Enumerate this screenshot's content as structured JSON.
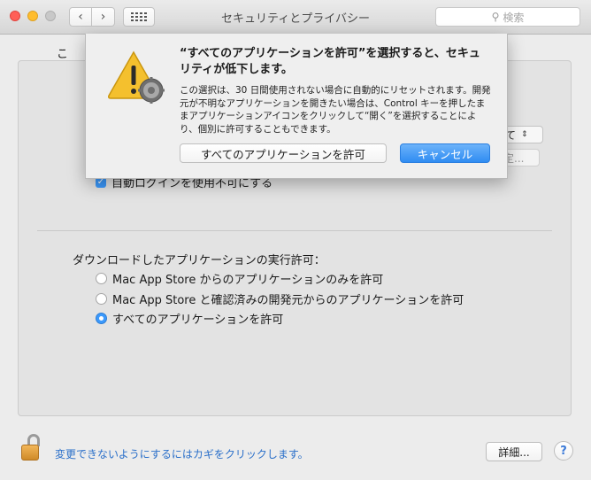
{
  "window": {
    "title": "セキュリティとプライバシー",
    "search_placeholder": "検索"
  },
  "panel": {
    "obscured_fragment": "こ",
    "obscured_select_value": "て",
    "obscured_button_label": "定...",
    "auto_login_label": "自動ログインを使用不可にする",
    "auto_login_checked": true,
    "download_heading": "ダウンロードしたアプリケーションの実行許可：",
    "options": [
      {
        "label": "Mac App Store からのアプリケーションのみを許可",
        "selected": false
      },
      {
        "label": "Mac App Store と確認済みの開発元からのアプリケーションを許可",
        "selected": false
      },
      {
        "label": "すべてのアプリケーションを許可",
        "selected": true
      }
    ]
  },
  "footer": {
    "lock_text": "変更できないようにするにはカギをクリックします。",
    "details_label": "詳細...",
    "help_label": "?"
  },
  "alert": {
    "title": "“すべてのアプリケーションを許可”を選択すると、セキュリティが低下します。",
    "body": "この選択は、30 日間使用されない場合に自動的にリセットされます。開発元が不明なアプリケーションを開きたい場合は、Control キーを押したままアプリケーションアイコンをクリックして“開く”を選択することにより、個別に許可することもできます。",
    "allow_button": "すべてのアプリケーションを許可",
    "cancel_button": "キャンセル"
  },
  "colors": {
    "accent": "#3b99fc",
    "link": "#2a6fc9",
    "warning": "#f5b800"
  },
  "icons": [
    "back-icon",
    "forward-icon",
    "grid-icon",
    "search-icon",
    "warning-icon",
    "gear-icon",
    "lock-icon",
    "help-icon"
  ]
}
